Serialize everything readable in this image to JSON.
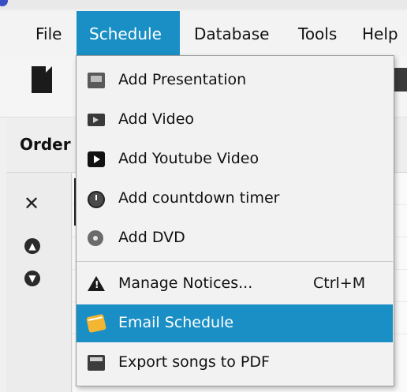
{
  "menubar": {
    "items": [
      {
        "label": "File"
      },
      {
        "label": "Schedule",
        "active": true
      },
      {
        "label": "Database"
      },
      {
        "label": "Tools"
      },
      {
        "label": "Help"
      }
    ]
  },
  "panel": {
    "order_label": "Order"
  },
  "schedule_menu": {
    "items": [
      {
        "label": "Add Presentation",
        "icon": "presentation-icon"
      },
      {
        "label": "Add Video",
        "icon": "video-icon"
      },
      {
        "label": "Add Youtube Video",
        "icon": "youtube-icon"
      },
      {
        "label": "Add countdown timer",
        "icon": "timer-icon"
      },
      {
        "label": "Add DVD",
        "icon": "dvd-icon"
      },
      {
        "label": "Manage Notices...",
        "icon": "warning-icon",
        "shortcut": "Ctrl+M"
      },
      {
        "label": "Email Schedule",
        "icon": "email-icon",
        "selected": true
      },
      {
        "label": "Export songs to PDF",
        "icon": "pdf-icon"
      }
    ]
  },
  "colors": {
    "accent": "#1a8fc5",
    "menu_bg": "#f2f2f2"
  }
}
